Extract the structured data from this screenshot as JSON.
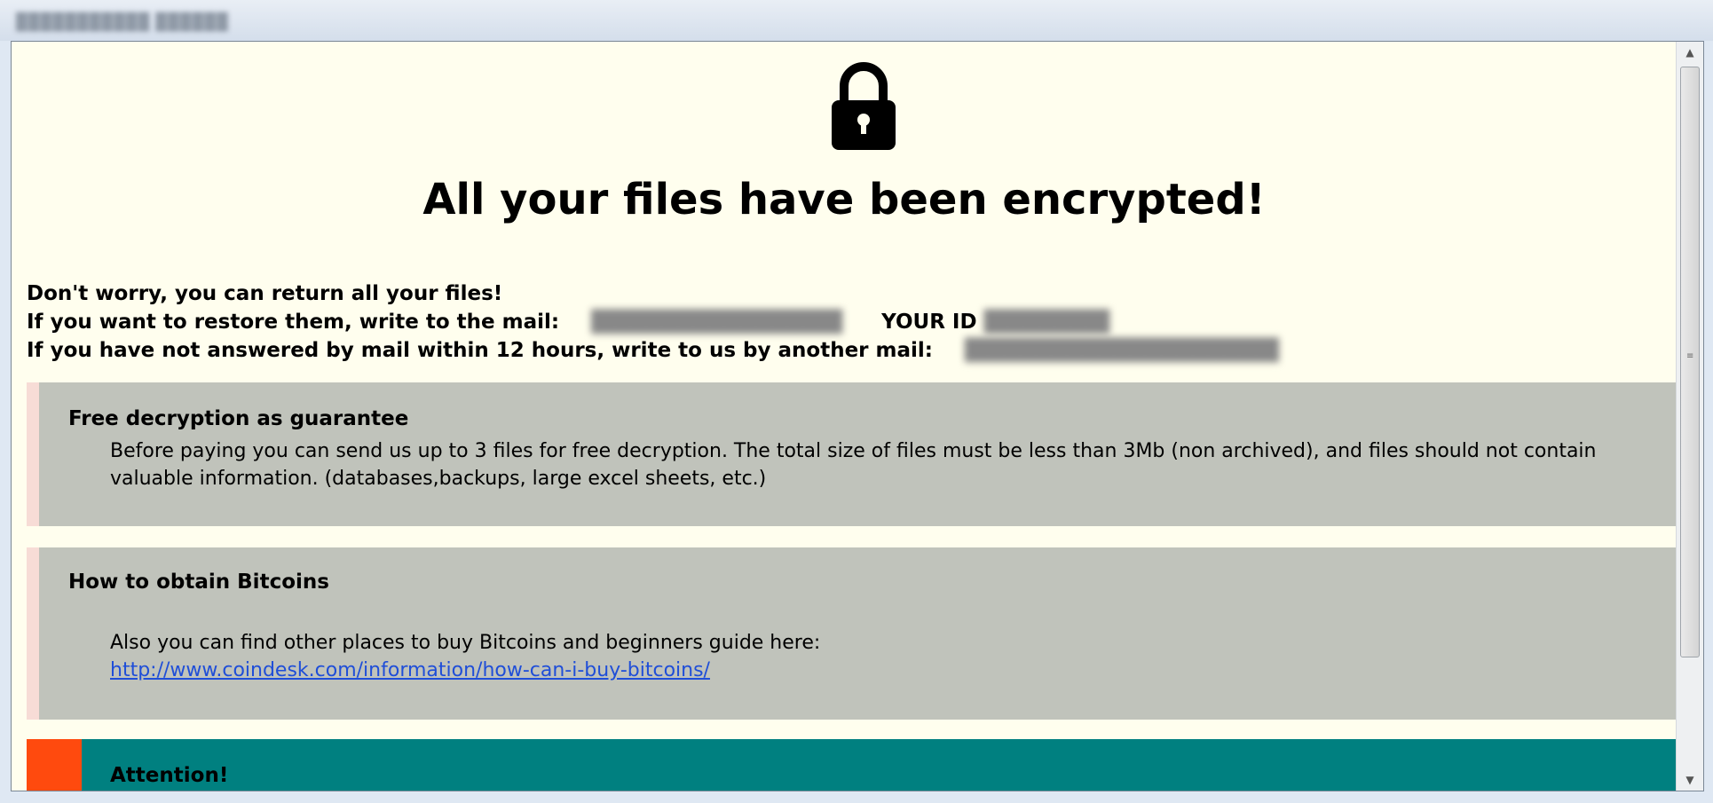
{
  "window": {
    "title": "███████████ ██████"
  },
  "header": {
    "lock_icon": "padlock-icon",
    "headline": "All your files have been encrypted!"
  },
  "info": {
    "line1": "Don't worry, you can return all your files!",
    "line2_label": "If you want to restore them, write to the mail:",
    "email_primary": "████████████████",
    "id_label": "YOUR ID",
    "id_value": "████████",
    "line3_label": "If you have not answered by mail within 12 hours, write to us by another mail:",
    "email_secondary": "████████████████████"
  },
  "panels": [
    {
      "title": "Free decryption as guarantee",
      "text": "Before paying you can send us up to 3 files for free decryption. The total size of files must be less than 3Mb (non archived), and files should not contain valuable information. (databases,backups, large excel sheets, etc.)"
    },
    {
      "title": "How to obtain Bitcoins",
      "text": "Also you can find other places to buy Bitcoins and beginners guide here:",
      "link": "http://www.coindesk.com/information/how-can-i-buy-bitcoins/"
    }
  ],
  "attention": {
    "title": "Attention!"
  },
  "colors": {
    "page_background": "#fffeee",
    "panel_background": "#c0c3bb",
    "panel_accent": "#f7dcd6",
    "attention_background": "#008080",
    "attention_accent": "#ff4a0e",
    "link": "#1f4ed8"
  },
  "scrollbar": {
    "up_arrow": "▲",
    "down_arrow": "▼"
  }
}
